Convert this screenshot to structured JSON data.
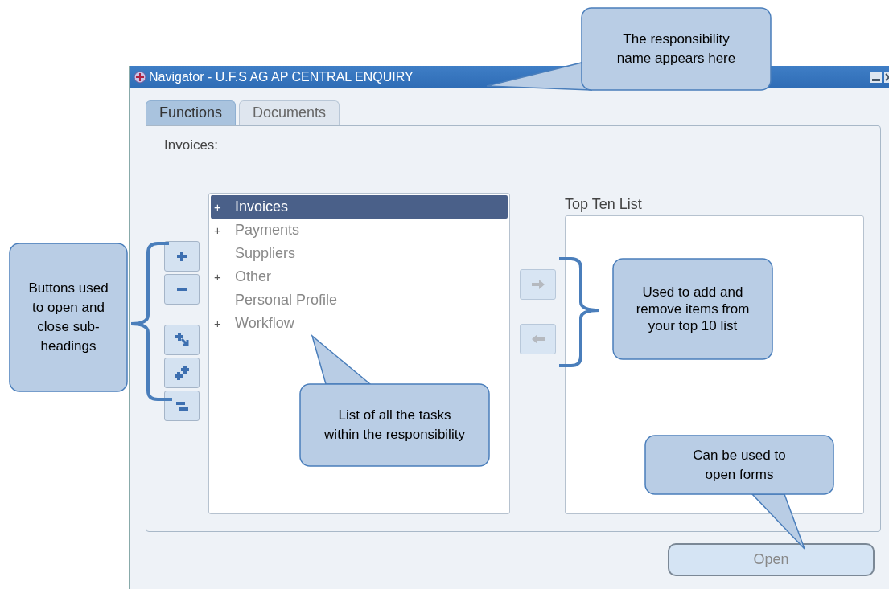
{
  "window": {
    "title": "Navigator - U.F.S AG AP CENTRAL ENQUIRY"
  },
  "tabs": [
    {
      "label": "Functions",
      "selected": true
    },
    {
      "label": "Documents",
      "selected": false
    }
  ],
  "path_label": "Invoices:",
  "tree": {
    "items": [
      {
        "expander": "+",
        "label": "Invoices",
        "selected": true
      },
      {
        "expander": "+",
        "label": "Payments",
        "selected": false
      },
      {
        "label": "Suppliers",
        "selected": false
      },
      {
        "expander": "+",
        "label": "Other",
        "selected": false
      },
      {
        "label": "Personal Profile",
        "selected": false
      },
      {
        "expander": "+",
        "label": "Workflow",
        "selected": false
      }
    ]
  },
  "top_ten": {
    "label": "Top Ten List"
  },
  "open_button": {
    "label": "Open",
    "disabled": true
  },
  "annotations": [
    {
      "text": "The responsibility name appears here"
    },
    {
      "text": "Buttons used to open and close sub-headings"
    },
    {
      "text": "Used to add and remove items from your top 10 list"
    },
    {
      "text": "List of all the tasks within the responsibility"
    },
    {
      "text": "Can be used to open forms"
    }
  ]
}
